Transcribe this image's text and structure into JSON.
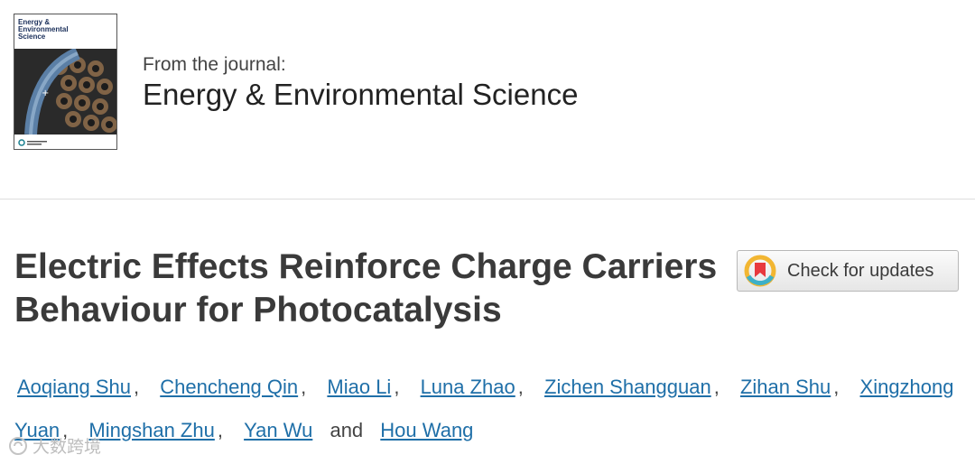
{
  "journal": {
    "kicker": "From the journal:",
    "name": "Energy & Environmental Science",
    "cover_title": "Energy &\nEnvironmental\nScience"
  },
  "article": {
    "title": "Electric Effects Reinforce Charge Carriers Behaviour for Photocatalysis"
  },
  "check_updates": {
    "label": "Check for updates"
  },
  "authors": [
    "Aoqiang Shu",
    "Chencheng Qin",
    "Miao Li",
    "Luna Zhao",
    "Zichen Shangguan",
    "Zihan Shu",
    "Xingzhong Yuan",
    "Mingshan Zhu",
    "Yan Wu",
    "Hou Wang"
  ],
  "separators": {
    "comma": ",",
    "and": "and"
  },
  "watermark": {
    "text": "大数跨境"
  },
  "colors": {
    "link": "#1f6fa8",
    "title": "#3a3a3a",
    "divider": "#dedede",
    "cover_navy": "#1a2f5a"
  }
}
